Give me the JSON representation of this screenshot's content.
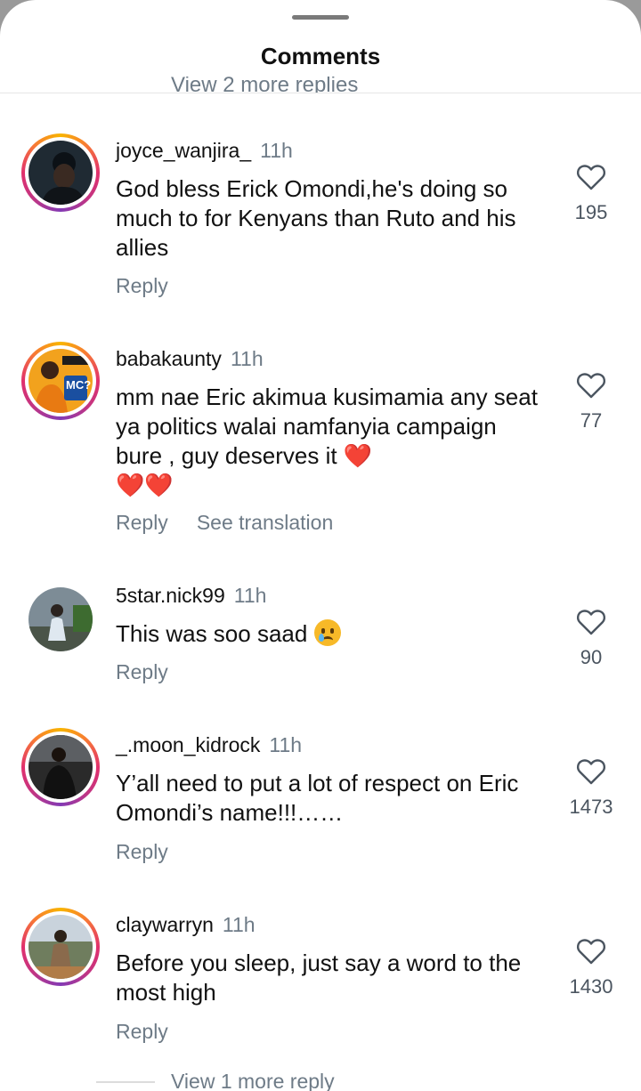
{
  "header": {
    "title": "Comments",
    "partial_replies": "View 2 more replies"
  },
  "comments": [
    {
      "username": "joyce_wanjira_",
      "time": "11h",
      "text": "God bless Erick Omondi,he's doing so much to for Kenyans than Ruto and his allies",
      "reply_label": "Reply",
      "likes": "195"
    },
    {
      "username": "babakaunty",
      "time": "11h",
      "text_line1": "mm nae Eric  akimua kusimamia any seat ya politics walai namfanyia campaign  bure , guy deserves  it",
      "hearts_inline": "❤️",
      "hearts_next": "❤️❤️",
      "reply_label": "Reply",
      "translate_label": "See translation",
      "likes": "77",
      "avatar_badge": "MC?"
    },
    {
      "username": "5star.nick99",
      "time": "11h",
      "text": "This was soo saad",
      "emoji": "crying-face",
      "reply_label": "Reply",
      "likes": "90"
    },
    {
      "username": "_.moon_kidrock",
      "time": "11h",
      "text": "Y’all need to put a lot of  respect on Eric Omondi’s name!!!……",
      "reply_label": "Reply",
      "likes": "1473"
    },
    {
      "username": "claywarryn",
      "time": "11h",
      "text": "Before you sleep, just say a word to the most high",
      "reply_label": "Reply",
      "likes": "1430"
    }
  ],
  "footer": {
    "view_more": "View 1 more reply"
  },
  "colors": {
    "secondary_text": "#6e7b87",
    "heart_emoji": "#dd1b2b",
    "story_ring": [
      "#f8b400",
      "#e1306c",
      "#833ab4"
    ]
  }
}
